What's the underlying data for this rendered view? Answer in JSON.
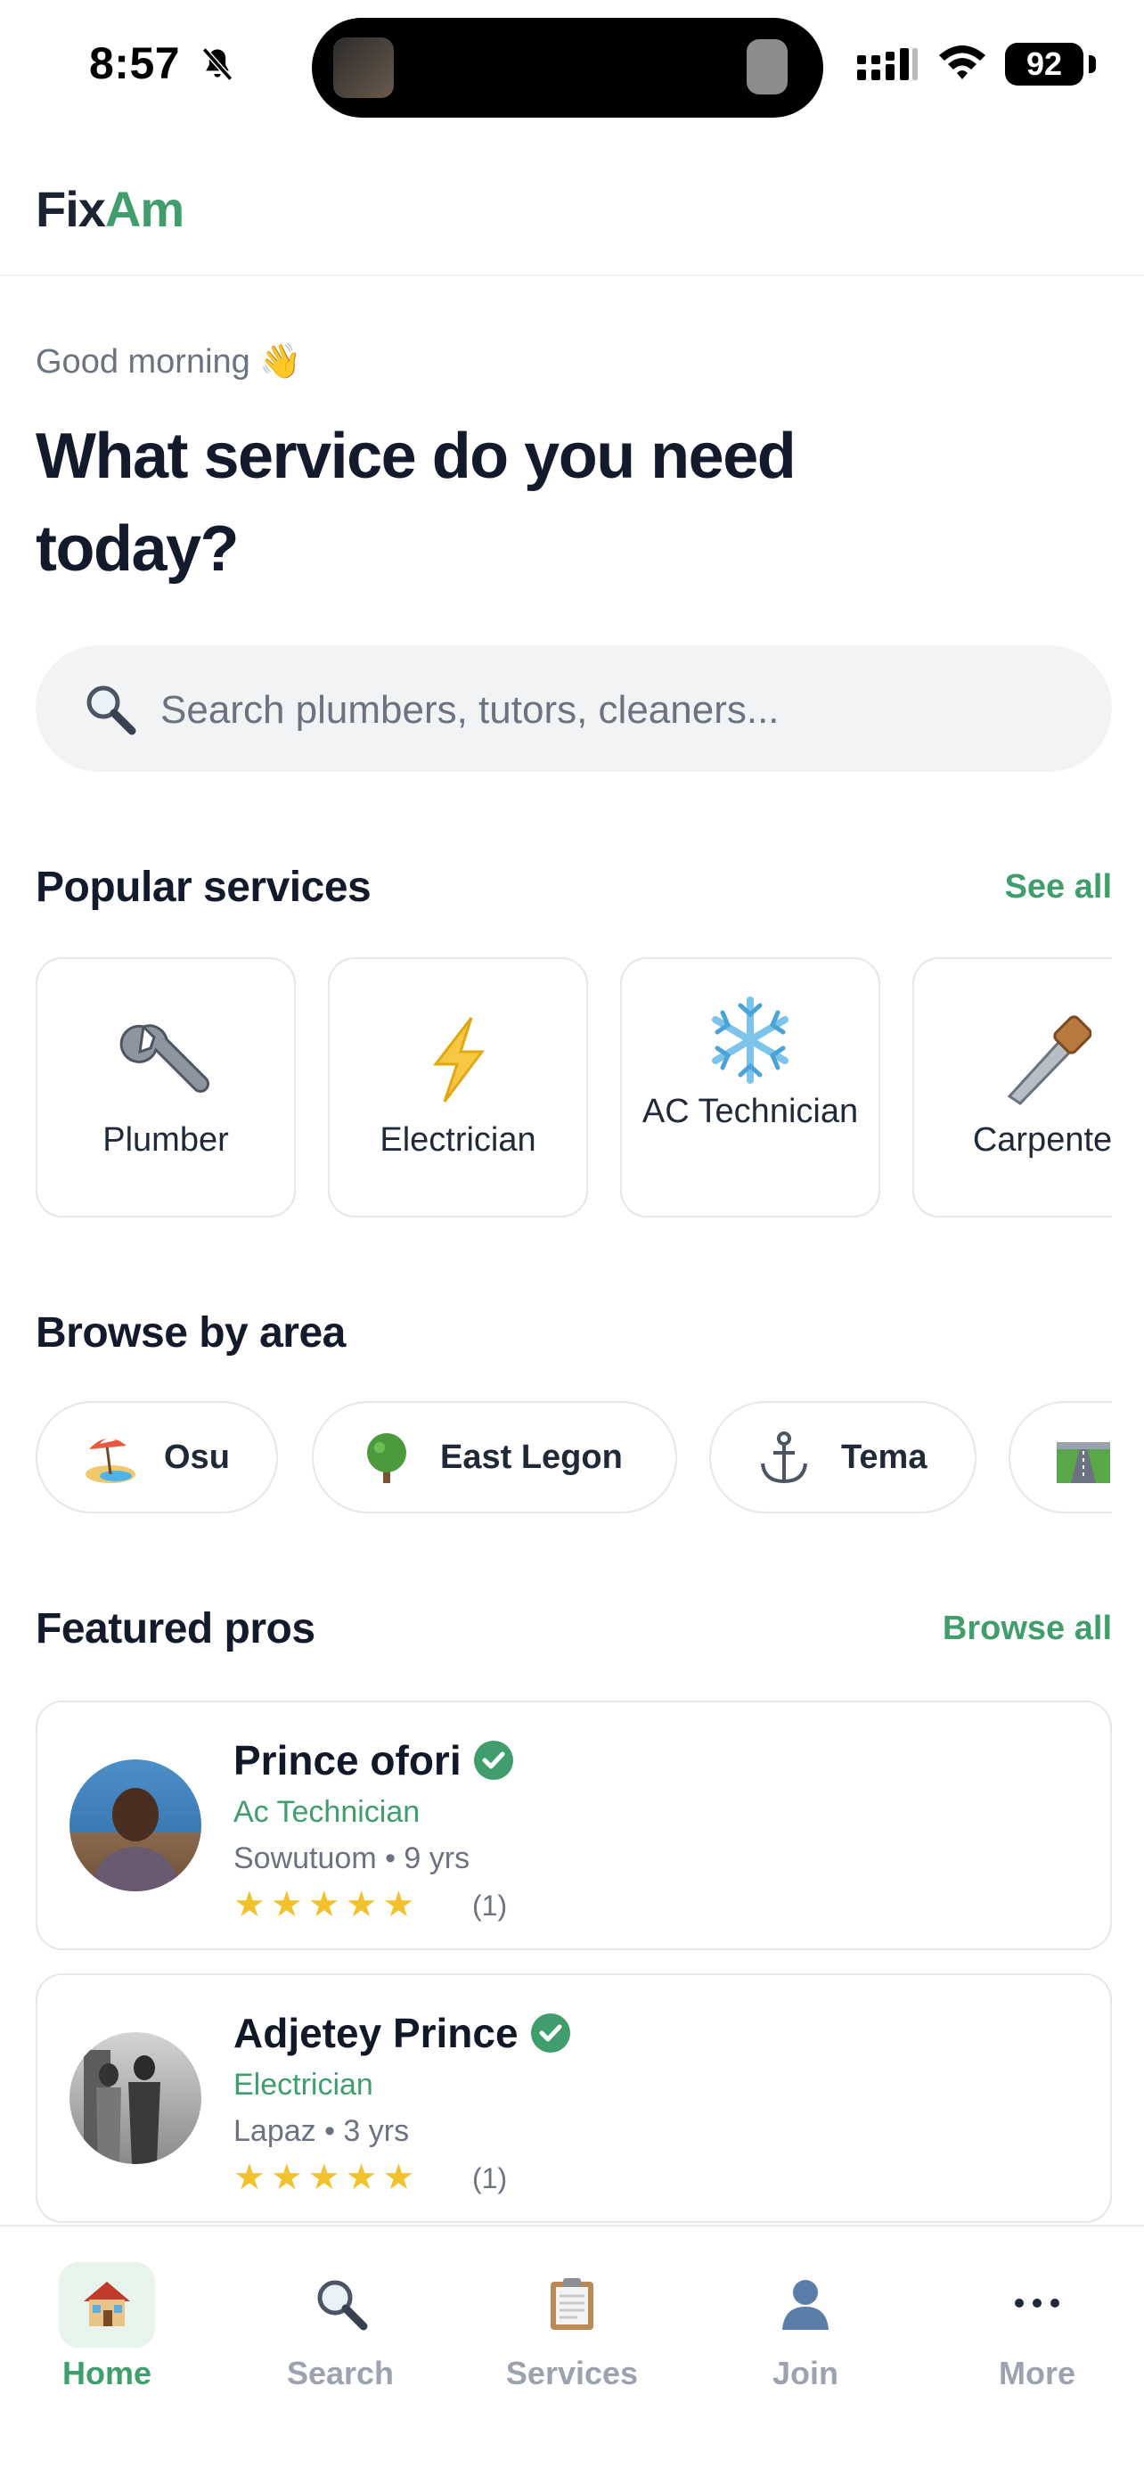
{
  "status_bar": {
    "time": "8:57",
    "battery": "92"
  },
  "app": {
    "logo_fix": "Fix",
    "logo_am": "Am",
    "accent": "#3f9e6c"
  },
  "hero": {
    "greeting": "Good morning 👋",
    "title": "What service do you need today?"
  },
  "search": {
    "placeholder": "Search plumbers, tutors, cleaners..."
  },
  "popular": {
    "title": "Popular services",
    "see_all": "See all",
    "items": [
      {
        "label": "Plumber",
        "icon": "wrench-icon"
      },
      {
        "label": "Electrician",
        "icon": "lightning-icon"
      },
      {
        "label": "AC Technician",
        "icon": "snowflake-icon"
      },
      {
        "label": "Carpente",
        "icon": "saw-icon"
      }
    ]
  },
  "areas": {
    "title": "Browse by area",
    "items": [
      {
        "label": "Osu",
        "icon": "beach-icon"
      },
      {
        "label": "East Legon",
        "icon": "tree-icon"
      },
      {
        "label": "Tema",
        "icon": "anchor-icon"
      },
      {
        "label": "",
        "icon": "motorway-icon"
      }
    ]
  },
  "featured": {
    "title": "Featured pros",
    "browse_all": "Browse all",
    "items": [
      {
        "name": "Prince ofori",
        "role": "Ac Technician",
        "meta": "Sowutuom • 9 yrs",
        "stars": "★★★★★",
        "rating": 5,
        "count": "(1)"
      },
      {
        "name": "Adjetey Prince",
        "role": "Electrician",
        "meta": "Lapaz • 3 yrs",
        "stars": "★★★★★",
        "rating": 5,
        "count": "(1)"
      }
    ]
  },
  "tabs": [
    {
      "label": "Home",
      "icon": "house-icon",
      "active": true
    },
    {
      "label": "Search",
      "icon": "magnifier-icon",
      "active": false
    },
    {
      "label": "Services",
      "icon": "clipboard-icon",
      "active": false
    },
    {
      "label": "Join",
      "icon": "person-icon",
      "active": false
    },
    {
      "label": "More",
      "icon": "more-icon",
      "active": false
    }
  ]
}
